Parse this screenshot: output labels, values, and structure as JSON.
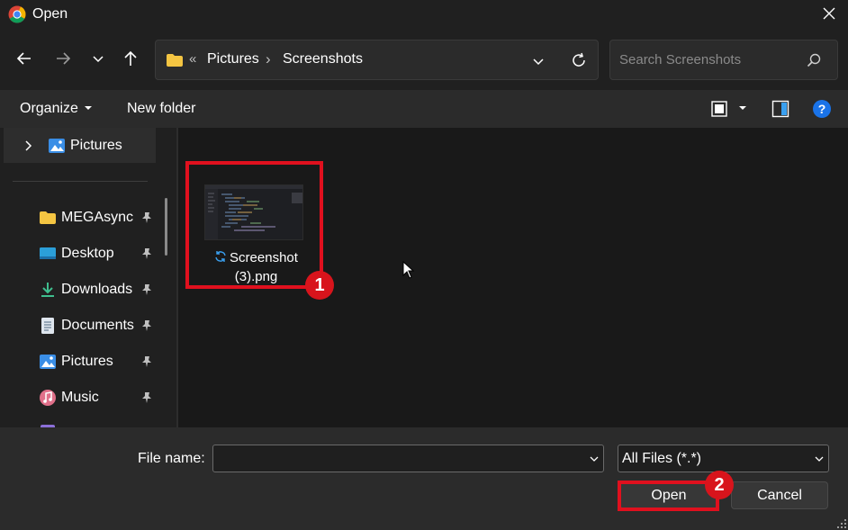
{
  "window": {
    "title": "Open",
    "app_icon": "chrome-icon",
    "close_icon": "close-icon"
  },
  "nav": {
    "back_icon": "arrow-left-icon",
    "forward_icon": "arrow-right-icon",
    "recent_icon": "chevron-down-icon",
    "up_icon": "arrow-up-icon",
    "address": {
      "overflow": "«",
      "crumbs": [
        "Pictures",
        "Screenshots"
      ],
      "separator": "›"
    },
    "refresh_icon": "refresh-icon",
    "search": {
      "placeholder": "Search Screenshots",
      "icon": "search-icon"
    }
  },
  "toolbar": {
    "organize_label": "Organize",
    "new_folder_label": "New folder",
    "view_icon": "view-mode-icon",
    "preview_icon": "preview-pane-icon",
    "help_icon": "help-icon"
  },
  "sidebar": {
    "selected": {
      "label": "Pictures",
      "icon": "pictures-icon"
    },
    "items": [
      {
        "label": "MEGAsync",
        "icon": "folder-icon",
        "pinned": true
      },
      {
        "label": "Desktop",
        "icon": "desktop-icon",
        "pinned": true
      },
      {
        "label": "Downloads",
        "icon": "download-icon",
        "pinned": true
      },
      {
        "label": "Documents",
        "icon": "documents-icon",
        "pinned": true
      },
      {
        "label": "Pictures",
        "icon": "pictures-icon",
        "pinned": true
      },
      {
        "label": "Music",
        "icon": "music-icon",
        "pinned": true
      }
    ]
  },
  "files": [
    {
      "name_line1": "Screenshot",
      "name_line2": "(3).png",
      "status_icon": "sync-icon"
    }
  ],
  "annotations": {
    "badge1": "1",
    "badge2": "2",
    "color": "#e0101e"
  },
  "bottom": {
    "filename_label": "File name:",
    "filename_value": "",
    "filetype_value": "All Files (*.*)",
    "open_label": "Open",
    "cancel_label": "Cancel"
  },
  "colors": {
    "background": "#202020",
    "content_bg": "#191919",
    "toolbar_bg": "#2b2b2b",
    "accent_blue": "#0078d4",
    "folder_yellow": "#f4c542"
  }
}
